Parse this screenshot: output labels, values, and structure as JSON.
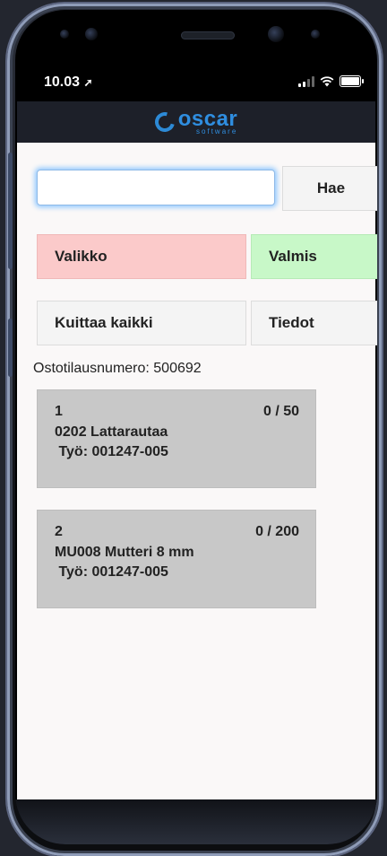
{
  "status": {
    "time": "10.03"
  },
  "app": {
    "logo_text": "oscar",
    "logo_subtext": "software"
  },
  "search": {
    "value": "",
    "placeholder": "",
    "button_label": "Hae"
  },
  "actions": {
    "menu_label": "Valikko",
    "done_label": "Valmis",
    "ack_all_label": "Kuittaa kaikki",
    "info_label": "Tiedot"
  },
  "order": {
    "line": "Ostotilausnumero: 500692"
  },
  "items": [
    {
      "index": "1",
      "qty": "0 / 50",
      "name": "0202 Lattarautaa",
      "work": " Työ: 001247-005"
    },
    {
      "index": "2",
      "qty": "0 / 200",
      "name": "MU008 Mutteri 8 mm",
      "work": " Työ: 001247-005"
    }
  ],
  "colors": {
    "menu_bg": "#fbcaca",
    "done_bg": "#c8f8c8",
    "card_bg": "#c8c8c8",
    "appbar_bg": "#1d2029",
    "logo": "#2f8ee0"
  }
}
